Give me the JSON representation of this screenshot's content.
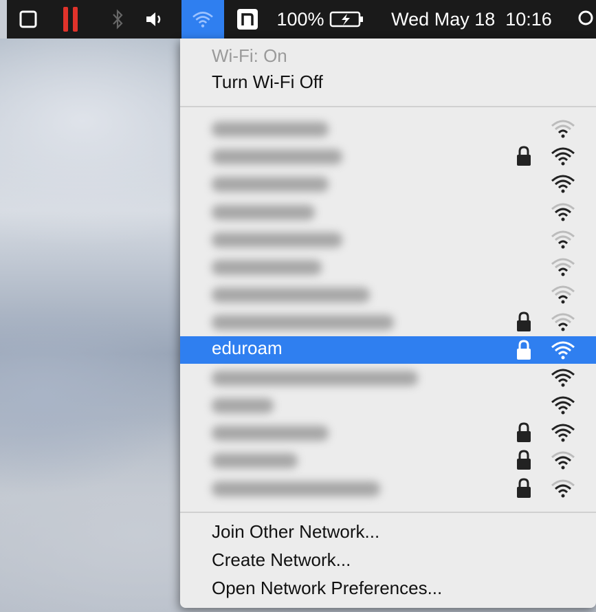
{
  "menubar": {
    "battery_percent": "100%",
    "datetime": "Wed May 18  10:16"
  },
  "wifi_menu": {
    "status": "Wi-Fi: On",
    "toggle_label": "Turn Wi-Fi Off",
    "networks": [
      {
        "name": "",
        "locked": false,
        "signal": 1
      },
      {
        "name": "",
        "locked": true,
        "signal": 3
      },
      {
        "name": "",
        "locked": false,
        "signal": 3
      },
      {
        "name": "",
        "locked": false,
        "signal": 2
      },
      {
        "name": "",
        "locked": false,
        "signal": 1
      },
      {
        "name": "",
        "locked": false,
        "signal": 1
      },
      {
        "name": "",
        "locked": false,
        "signal": 1
      },
      {
        "name": "",
        "locked": true,
        "signal": 1
      },
      {
        "name": "eduroam",
        "locked": true,
        "signal": 3,
        "selected": true
      },
      {
        "name": "",
        "locked": false,
        "signal": 3
      },
      {
        "name": "",
        "locked": false,
        "signal": 3
      },
      {
        "name": "",
        "locked": true,
        "signal": 3
      },
      {
        "name": "",
        "locked": true,
        "signal": 2
      },
      {
        "name": "",
        "locked": true,
        "signal": 2
      }
    ],
    "join_other": "Join Other Network...",
    "create_network": "Create Network...",
    "open_prefs": "Open Network Preferences..."
  },
  "colors": {
    "menubar_bg": "#1a1a1a",
    "highlight": "#2f7ff0",
    "menu_bg": "#ececec",
    "pause_red": "#e0332b"
  }
}
